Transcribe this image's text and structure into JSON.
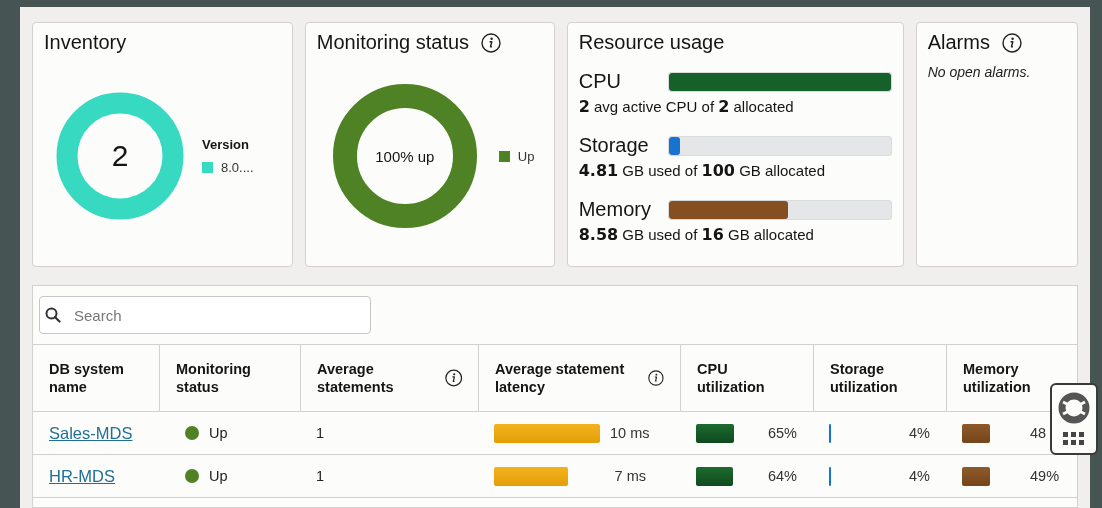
{
  "cards": {
    "inventory": {
      "title": "Inventory",
      "center_text": "2",
      "legend_title": "Version",
      "legend": [
        {
          "label": "8.0....",
          "color": "#37d9c1"
        }
      ]
    },
    "monitoring": {
      "title": "Monitoring status",
      "info": true,
      "center_text": "100% up",
      "legend": [
        {
          "label": "Up",
          "color": "#4f8224"
        }
      ]
    },
    "resources": {
      "title": "Resource usage",
      "items": [
        {
          "name": "CPU",
          "level": 1,
          "color": "#16612a",
          "summary": "**2** avg active CPU of **2** allocated"
        },
        {
          "name": "Storage",
          "level": 0.048,
          "color": "#1872d0",
          "summary": "**4.81** GB used of **100** GB allocated"
        },
        {
          "name": "Memory",
          "level": 0.536,
          "color": "#854f22",
          "summary": "**8.58** GB used of **16** GB allocated"
        }
      ]
    },
    "alarms": {
      "title": "Alarms",
      "info": true,
      "message": "No open alarms."
    }
  },
  "search": {
    "placeholder": "Search"
  },
  "table": {
    "columns": [
      {
        "label": "DB system name",
        "info": false
      },
      {
        "label": "Monitoring status",
        "info": false
      },
      {
        "label": "Average statements",
        "info": true
      },
      {
        "label": "Average statement latency",
        "info": true
      },
      {
        "label": "CPU utilization",
        "info": false
      },
      {
        "label": "Storage utilization",
        "info": false
      },
      {
        "label": "Memory utilization",
        "info": false
      }
    ],
    "rows": [
      {
        "name": "Sales-MDS",
        "status": "Up",
        "color": "#4f8224",
        "statements": "1",
        "latency": "10 ms",
        "cpu": "65%",
        "storage": "4%",
        "memory": "48"
      },
      {
        "name": "HR-MDS",
        "status": "Up",
        "color": "#4f8224",
        "statements": "1",
        "latency": "7 ms",
        "cpu": "64%",
        "storage": "4%",
        "memory": "49%"
      }
    ]
  }
}
